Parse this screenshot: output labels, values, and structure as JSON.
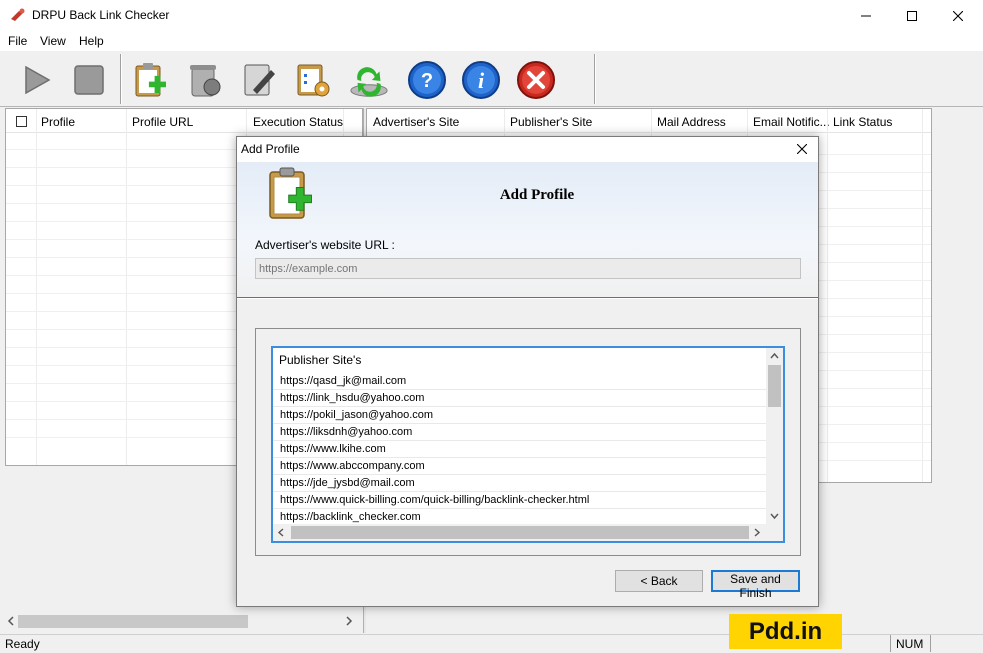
{
  "window": {
    "title": "DRPU Back Link Checker"
  },
  "menu": [
    "File",
    "View",
    "Help"
  ],
  "toolbar": {
    "buttons": [
      {
        "icon": "play-icon"
      },
      {
        "icon": "stop-icon"
      },
      {
        "icon": "add-profile-icon"
      },
      {
        "icon": "delete-profile-icon"
      },
      {
        "icon": "edit-profile-icon"
      },
      {
        "icon": "settings-icon"
      },
      {
        "icon": "refresh-icon"
      },
      {
        "icon": "help-icon"
      },
      {
        "icon": "info-icon"
      },
      {
        "icon": "exit-icon"
      }
    ]
  },
  "left_grid": {
    "columns": [
      "Profile",
      "Profile URL",
      "Execution Status"
    ]
  },
  "right_grid": {
    "columns": [
      "Advertiser's Site",
      "Publisher's Site",
      "Mail Address",
      "Email Notific...",
      "Link Status"
    ]
  },
  "status": {
    "text": "Ready",
    "num": "NUM"
  },
  "dialog": {
    "title": "Add Profile",
    "heading": "Add Profile",
    "url_label": "Advertiser's website URL :",
    "url_placeholder": "https://example.com",
    "publisher_header": "Publisher Site's",
    "publishers": [
      "https://qasd_jk@mail.com",
      "https://link_hsdu@yahoo.com",
      "https://pokil_jason@yahoo.com",
      "https://liksdnh@yahoo.com",
      "https://www.lkihe.com",
      "https://www.abccompany.com",
      "https://jde_jysbd@mail.com",
      "https://www.quick-billing.com/quick-billing/backlink-checker.html",
      "https://backlink_checker.com"
    ],
    "back_label": "< Back",
    "save_label": "Save and Finish"
  },
  "watermark": "Pdd.in",
  "colors": {
    "accent_blue": "#3b8de0",
    "watermark_yellow": "#ffd400"
  }
}
